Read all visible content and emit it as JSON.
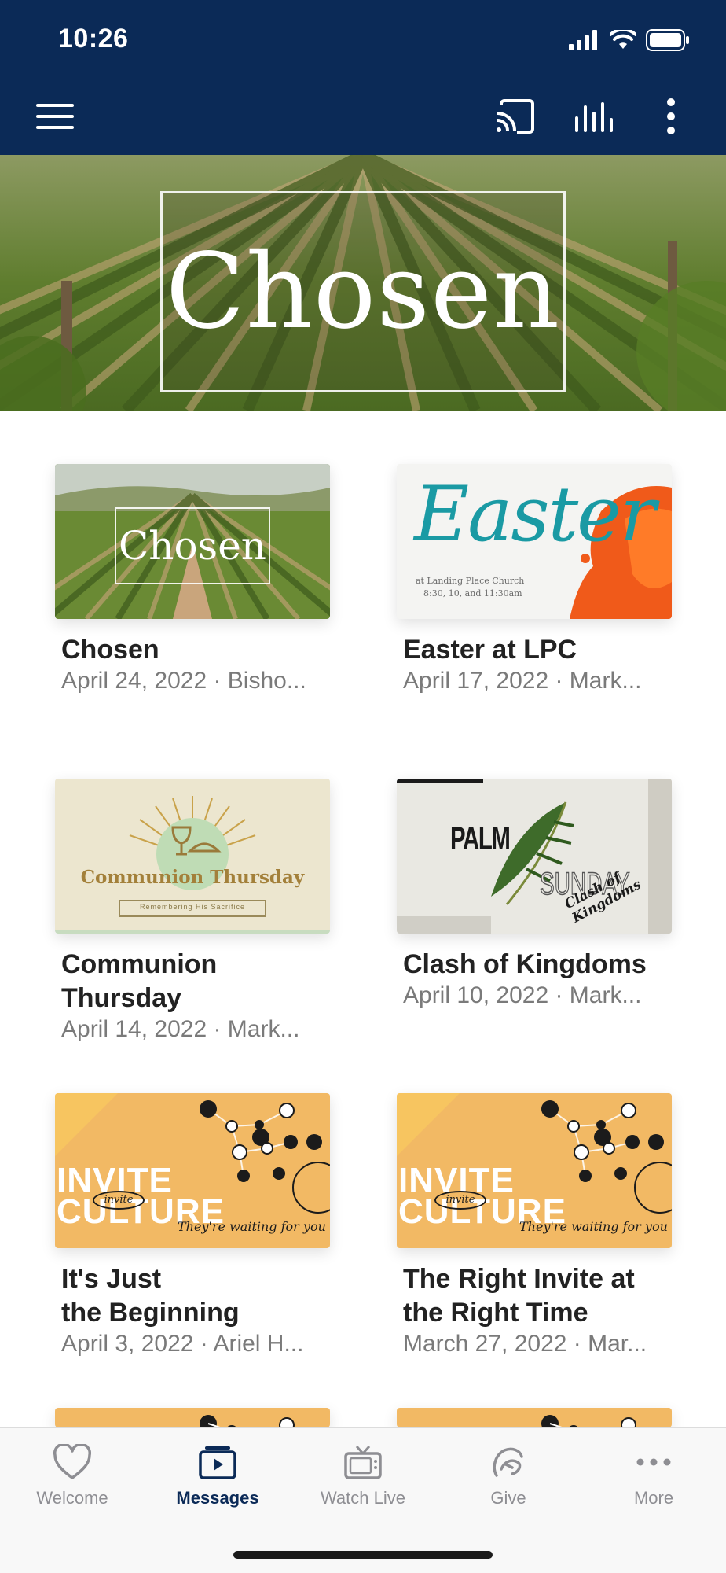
{
  "status_bar": {
    "time": "10:26"
  },
  "header": {
    "menu_icon": "hamburger-icon",
    "cast_icon": "cast-icon",
    "audio_icon": "audio-bars-icon",
    "more_icon": "vertical-dots-icon",
    "background_color": "#0b2a57"
  },
  "hero": {
    "title": "Chosen"
  },
  "messages": [
    {
      "title": "Chosen",
      "subtitle": "April 24, 2022 · Bisho...",
      "thumb": "vineyard",
      "thumb_text": "Chosen"
    },
    {
      "title": "Easter at LPC",
      "subtitle": "April 17, 2022 · Mark...",
      "thumb": "easter",
      "thumb_text": "Easter",
      "thumb_small": "at Landing Place Church",
      "thumb_small2": "8:30, 10, and 11:30am"
    },
    {
      "title": "Communion\nThursday",
      "subtitle": "April 14, 2022 · Mark...",
      "thumb": "communion",
      "thumb_text": "Communion Thursday",
      "thumb_small": "Remembering His Sacrifice"
    },
    {
      "title": "Clash of Kingdoms",
      "subtitle": "April 10, 2022 · Mark...",
      "thumb": "palm",
      "thumb_text": "PALM",
      "thumb_text2": "SUNDAY",
      "thumb_small": "Clash of Kingdoms"
    },
    {
      "title": "It's Just\nthe Beginning",
      "subtitle": "April 3, 2022 · Ariel H...",
      "thumb": "invite",
      "thumb_text": "INVITE",
      "thumb_text2": "CULTURE",
      "thumb_small": "They're waiting for you",
      "thumb_tag": "invite"
    },
    {
      "title": "The Right Invite at\nthe Right Time",
      "subtitle": "March 27, 2022 · Mar...",
      "thumb": "invite",
      "thumb_text": "INVITE",
      "thumb_text2": "CULTURE",
      "thumb_small": "They're waiting for you",
      "thumb_tag": "invite"
    }
  ],
  "tabs": [
    {
      "label": "Welcome",
      "icon": "heart-icon",
      "active": false
    },
    {
      "label": "Messages",
      "icon": "messages-icon",
      "active": true
    },
    {
      "label": "Watch Live",
      "icon": "tv-icon",
      "active": false
    },
    {
      "label": "Give",
      "icon": "give-icon",
      "active": false
    },
    {
      "label": "More",
      "icon": "more-dots-icon",
      "active": false
    }
  ],
  "colors": {
    "accent": "#0b2a57",
    "invite_yellow": "#f2b964",
    "tab_inactive": "#8e8e93"
  }
}
